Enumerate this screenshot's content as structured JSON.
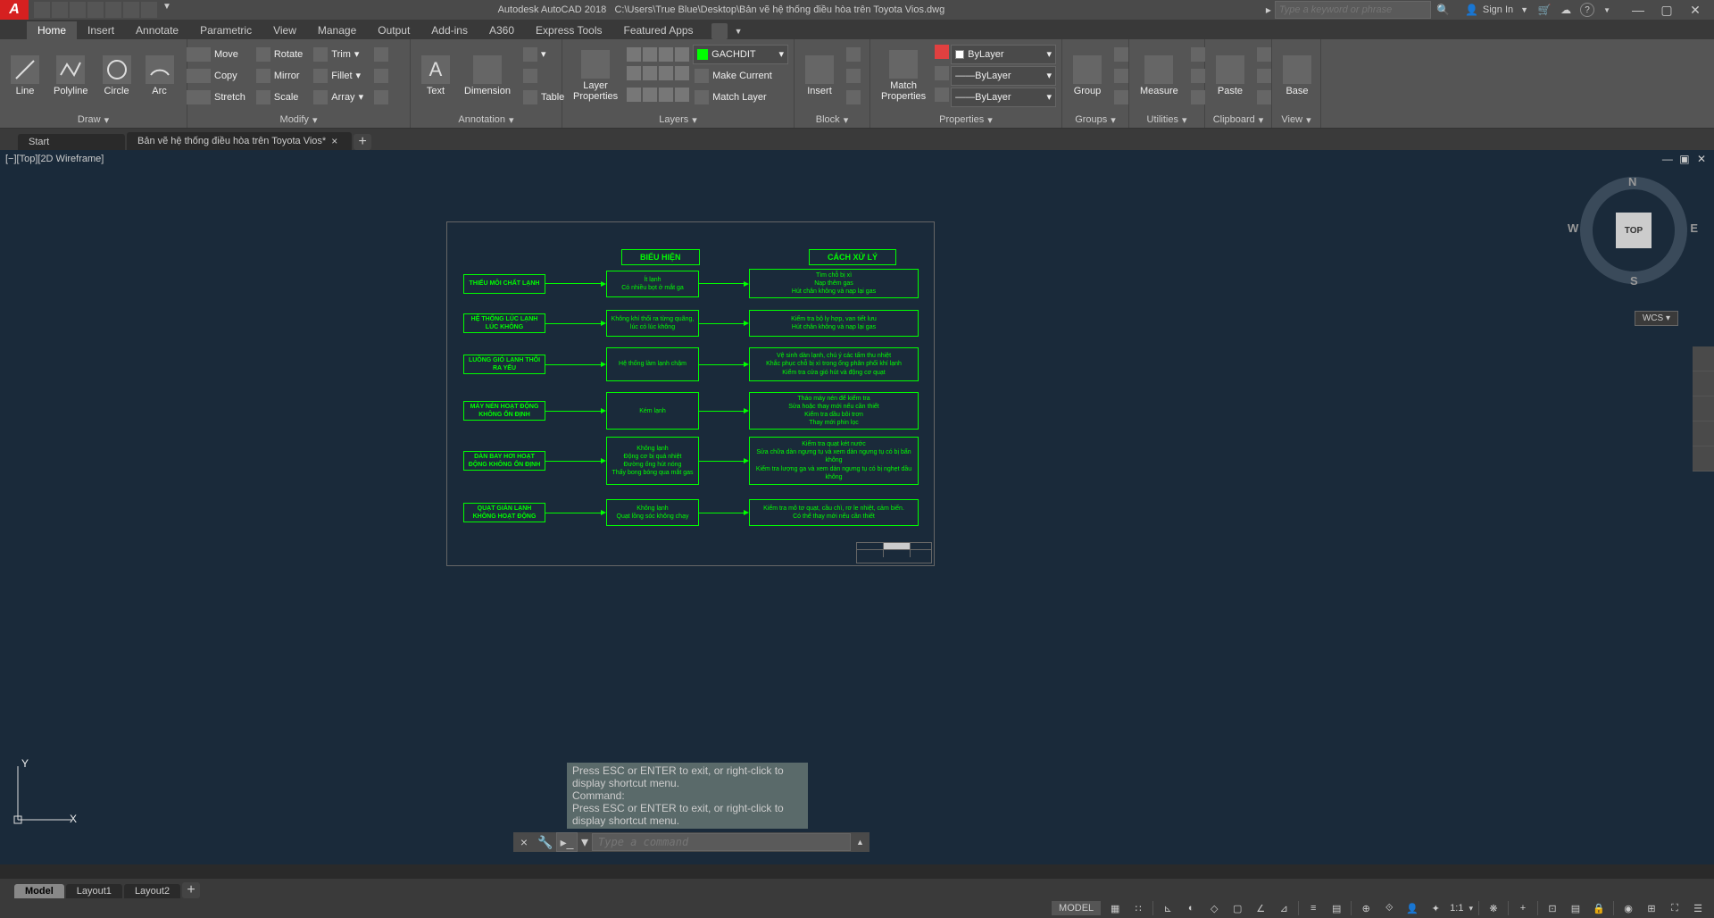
{
  "titlebar": {
    "app": "Autodesk AutoCAD 2018",
    "path": "C:\\Users\\True Blue\\Desktop\\Bản vẽ hệ thống điều hòa trên Toyota Vios.dwg",
    "search_placeholder": "Type a keyword or phrase",
    "signin": "Sign In"
  },
  "ribbon": {
    "tabs": [
      "Home",
      "Insert",
      "Annotate",
      "Parametric",
      "View",
      "Manage",
      "Output",
      "Add-ins",
      "A360",
      "Express Tools",
      "Featured Apps"
    ],
    "draw": {
      "line": "Line",
      "polyline": "Polyline",
      "circle": "Circle",
      "arc": "Arc",
      "title": "Draw"
    },
    "modify": {
      "move": "Move",
      "copy": "Copy",
      "stretch": "Stretch",
      "rotate": "Rotate",
      "mirror": "Mirror",
      "scale": "Scale",
      "trim": "Trim",
      "fillet": "Fillet",
      "array": "Array",
      "title": "Modify"
    },
    "annotation": {
      "text": "Text",
      "dimension": "Dimension",
      "table": "Table",
      "title": "Annotation"
    },
    "layers": {
      "properties": "Layer\nProperties",
      "current": "GACHDIT",
      "make_current": "Make Current",
      "match": "Match Layer",
      "title": "Layers"
    },
    "block": {
      "insert": "Insert",
      "title": "Block"
    },
    "properties": {
      "match": "Match\nProperties",
      "bylayer": "ByLayer",
      "title": "Properties"
    },
    "groups": {
      "group": "Group",
      "title": "Groups"
    },
    "utilities": {
      "measure": "Measure",
      "title": "Utilities"
    },
    "clipboard": {
      "paste": "Paste",
      "title": "Clipboard"
    },
    "view_panel": {
      "base": "Base",
      "title": "View"
    }
  },
  "doc_tabs": {
    "start": "Start",
    "file": "Bản vẽ hệ thống điều hòa trên Toyota Vios*"
  },
  "viewport": {
    "label": "[−][Top][2D Wireframe]"
  },
  "nav": {
    "top": "TOP",
    "n": "N",
    "e": "E",
    "s": "S",
    "w": "W",
    "wcs": "WCS"
  },
  "flowchart": {
    "h1": "BIỂU HIỆN",
    "h2": "CÁCH XỬ LÝ",
    "rows": [
      {
        "c1": "THIẾU MÔI CHẤT LẠNH",
        "c2": "Ít lạnh\nCó nhiều bọt ở mắt ga",
        "c3": "Tìm chỗ bị xì\nNạp thêm gas\nHút chân không và nạp lại gas"
      },
      {
        "c1": "HỆ THỐNG LÚC LẠNH LÚC KHÔNG",
        "c2": "Không khí thổi ra từng quãng, lúc có lúc không",
        "c3": "Kiểm tra bộ ly hợp, van tiết lưu\nHút chân không và nạp lại gas"
      },
      {
        "c1": "LUỒNG GIÓ LẠNH THỔI RA YẾU",
        "c2": "Hệ thống làm lạnh chậm",
        "c3": "Vệ sinh dàn lạnh, chú ý các tấm thu nhiệt\nKhắc phục chỗ bị xì trong ống phân phối khí lạnh\nKiểm tra cửa gió hút và động cơ quạt"
      },
      {
        "c1": "MÁY NÉN HOẠT ĐỘNG KHÔNG ỔN ĐỊNH",
        "c2": "Kém lạnh",
        "c3": "Tháo máy nén để kiểm tra\nSửa hoặc thay mới nếu cần thiết\nKiểm tra dầu bôi trơn\nThay mới phin lọc"
      },
      {
        "c1": "DÀN BAY HƠI HOẠT ĐỘNG KHÔNG ỔN ĐỊNH",
        "c2": "Không lạnh\nĐộng cơ bị quá nhiệt\nĐường ống hút nóng\nThấy bong bóng qua mắt gas",
        "c3": "Kiểm tra quạt két nước\nSửa chữa dàn ngưng tụ và xem dàn ngưng tụ có bị bẩn không\nKiểm tra lượng ga và xem dàn ngưng tụ có bị nghẹt dầu không"
      },
      {
        "c1": "QUẠT GIÀN LẠNH KHÔNG HOẠT ĐỘNG",
        "c2": "Không lạnh\nQuạt lồng sóc không chạy",
        "c3": "Kiểm tra mô tơ quạt, cầu chì, rơ le nhiệt, cảm biến.\nCó thể thay mới nếu cần thiết"
      }
    ]
  },
  "ucs": {
    "x": "X",
    "y": "Y"
  },
  "cmd": {
    "history1": "Press ESC or ENTER to exit, or right-click to display shortcut menu.",
    "history2": "Command:",
    "history3": "Press ESC or ENTER to exit, or right-click to display shortcut menu.",
    "placeholder": "Type a command"
  },
  "model_tabs": {
    "model": "Model",
    "layout1": "Layout1",
    "layout2": "Layout2"
  },
  "status": {
    "model": "MODEL",
    "scale": "1:1"
  }
}
